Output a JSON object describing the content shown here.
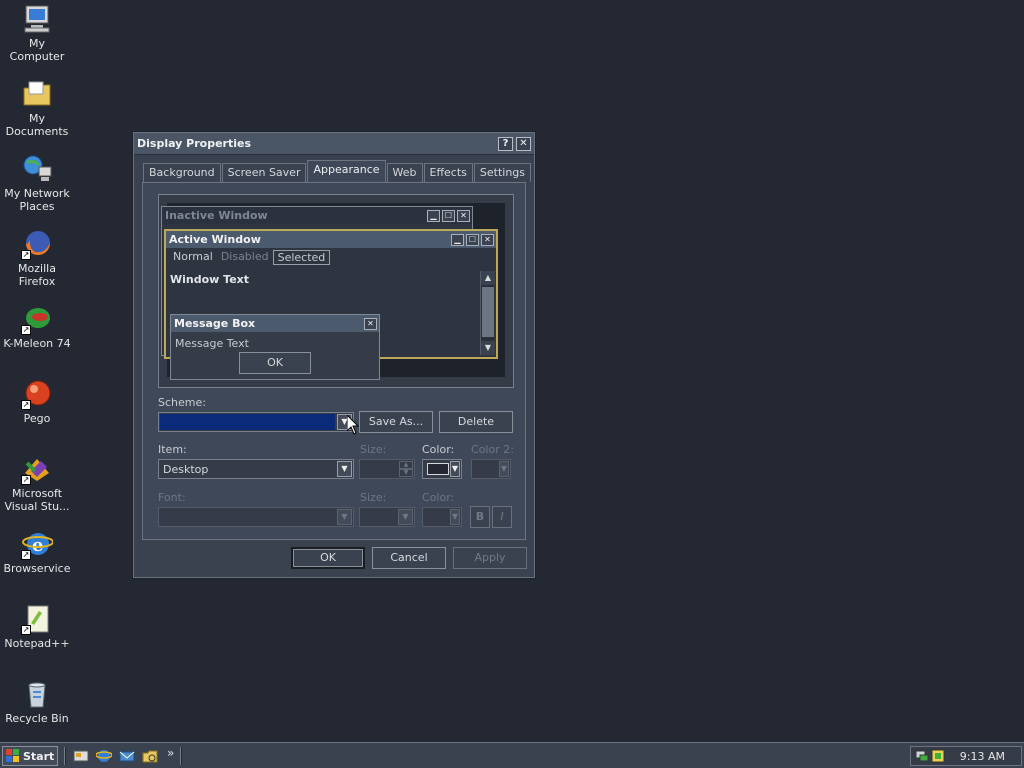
{
  "desktop": {
    "icons": [
      {
        "label": "My Computer"
      },
      {
        "label": "My Documents"
      },
      {
        "label": "My Network Places"
      },
      {
        "label": "Mozilla Firefox"
      },
      {
        "label": "K-Meleon 74"
      },
      {
        "label": "Pego"
      },
      {
        "label": "Microsoft Visual Stu..."
      },
      {
        "label": "Browservice"
      },
      {
        "label": "Notepad++"
      },
      {
        "label": "Recycle Bin"
      }
    ]
  },
  "window": {
    "title": "Display Properties",
    "help_btn": "?",
    "close_btn": "✕",
    "tabs": [
      "Background",
      "Screen Saver",
      "Appearance",
      "Web",
      "Effects",
      "Settings"
    ],
    "active_tab": "Appearance",
    "preview": {
      "inactive_title": "Inactive Window",
      "active_title": "Active Window",
      "menu": {
        "normal": "Normal",
        "disabled": "Disabled",
        "selected": "Selected"
      },
      "window_text": "Window Text",
      "msgbox_title": "Message Box",
      "msgbox_text": "Message Text",
      "msgbox_ok": "OK"
    },
    "scheme_label": "Scheme:",
    "scheme_value": "",
    "save_as_label": "Save As...",
    "delete_label": "Delete",
    "item_label": "Item:",
    "item_value": "Desktop",
    "size_label": "Size:",
    "color_label": "Color:",
    "color2_label": "Color 2:",
    "font_label": "Font:",
    "font_size_label": "Size:",
    "font_color_label": "Color:",
    "bold_label": "B",
    "italic_label": "I",
    "ok_label": "OK",
    "cancel_label": "Cancel",
    "apply_label": "Apply"
  },
  "taskbar": {
    "start_label": "Start",
    "chevron": "»",
    "clock": "9:13 AM"
  },
  "colors": {
    "desktop": "#232833",
    "scheme_selection": "#0c2a7a",
    "item_color": "#232833"
  }
}
